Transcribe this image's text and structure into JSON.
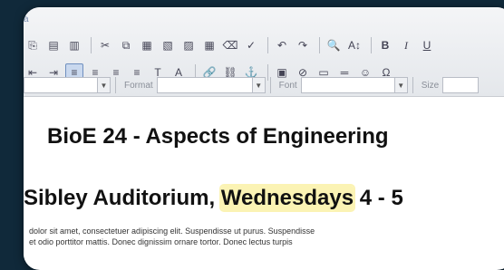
{
  "toolbar": {
    "tag_fragment": "a",
    "row1": {
      "icons": [
        "new-doc-icon",
        "copy-doc-icon",
        "paste-doc-icon",
        "cut-icon",
        "copy-icon",
        "paste-icon",
        "paste-text-icon",
        "paste-word-icon",
        "table-icon",
        "eraser-icon",
        "spellcheck-icon",
        "undo-icon",
        "redo-icon",
        "find-icon",
        "replace-icon"
      ],
      "glyphs": [
        "⎘",
        "▤",
        "▥",
        "✂",
        "⧉",
        "▦",
        "▧",
        "▨",
        "▦",
        "⌫",
        "✓",
        "↶",
        "↷",
        "🔍",
        "A↕"
      ],
      "bold": "B",
      "italic": "I",
      "underline": "U"
    },
    "row2": {
      "glyphs": [
        "⇤",
        "⇥",
        "≡",
        "≡",
        "≡",
        "≡",
        "T",
        "A",
        "🔗",
        "⛓",
        "⚓",
        "▣",
        "⊘",
        "▭",
        "═",
        "☺",
        "Ω"
      ]
    },
    "row3": {
      "format_label": "Format",
      "font_label": "Font",
      "size_label": "Size"
    }
  },
  "content": {
    "heading_line1": "BioE 24 - Aspects of Engineering",
    "heading_line2_pre": "Sibley Auditorium, ",
    "heading_line2_highlight": "Wednesdays",
    "heading_line2_post": " 4 - 5",
    "para_line1": "dolor sit amet, consectetuer adipiscing elit. Suspendisse ut purus. Suspendisse",
    "para_line2": "et odio porttitor mattis. Donec dignissim ornare tortor. Donec lectus turpis"
  },
  "colors": {
    "highlight": "#fbf3b4",
    "background": "#10293a"
  }
}
